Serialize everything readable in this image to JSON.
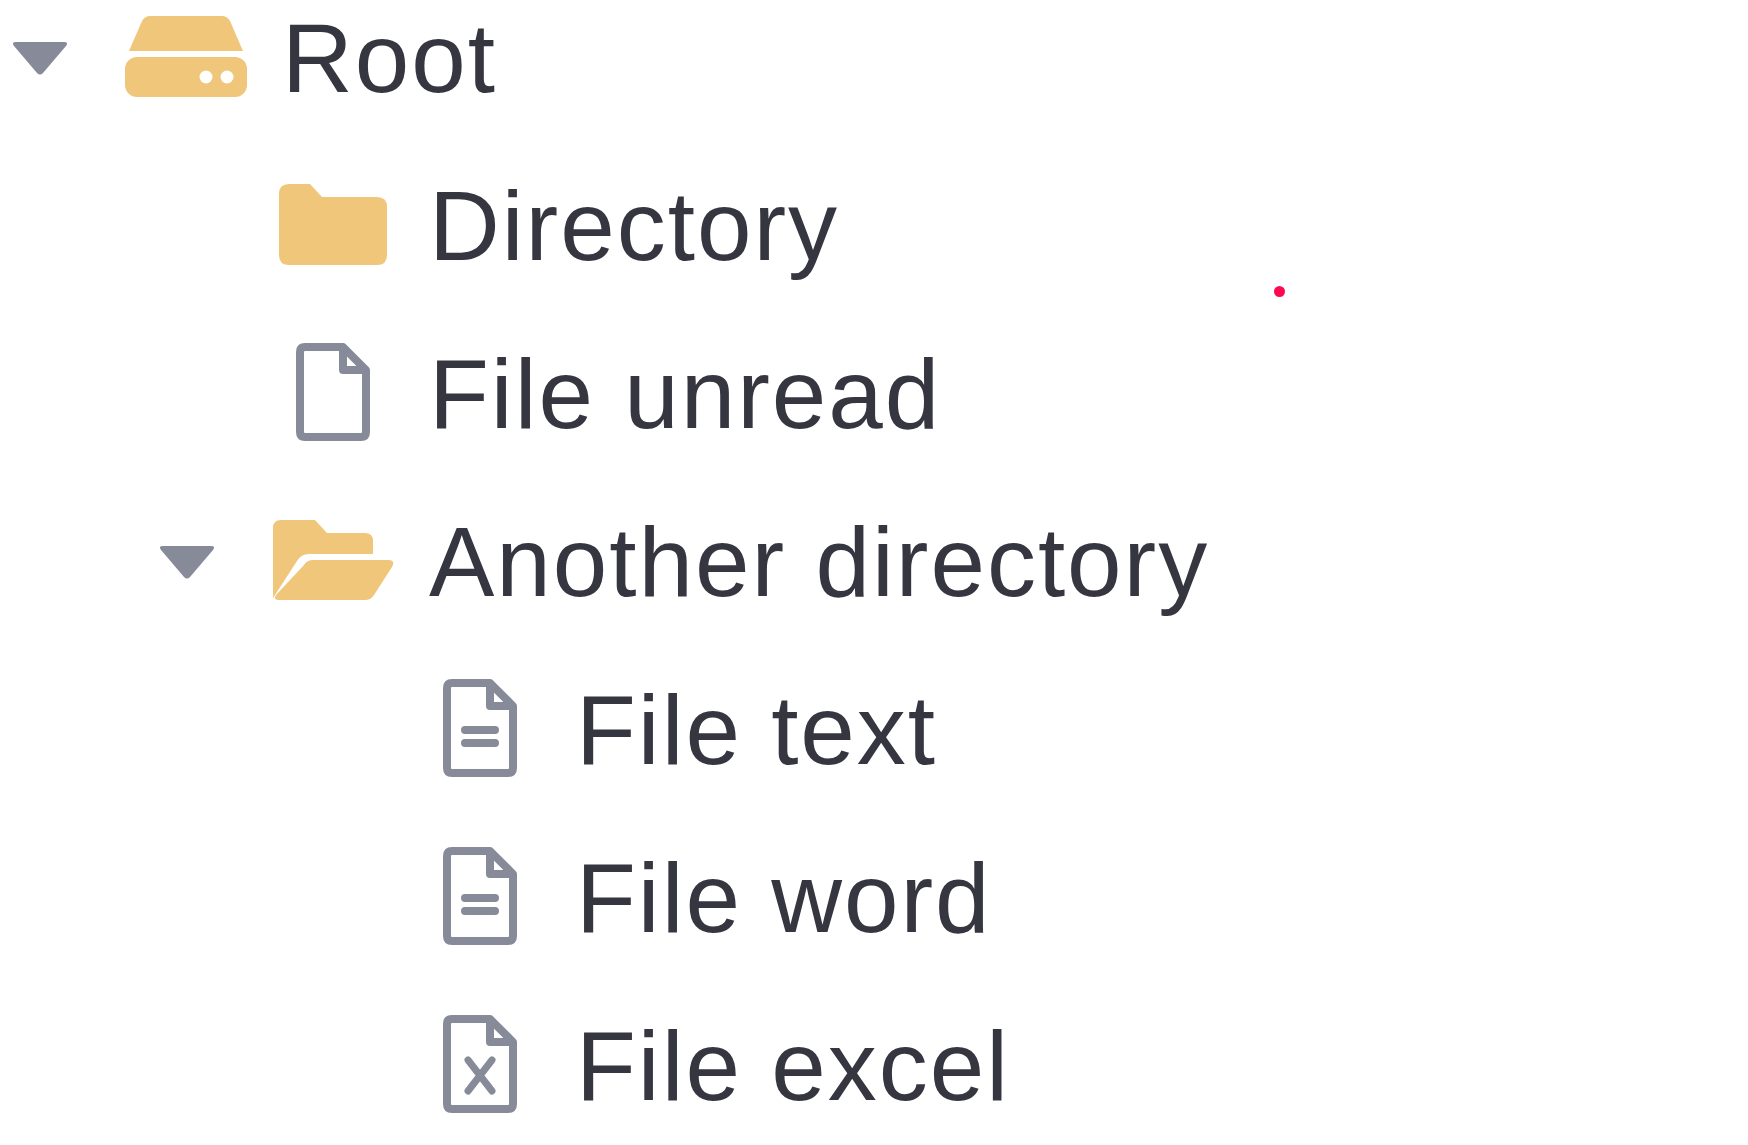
{
  "tree": {
    "items": [
      {
        "label": "Root",
        "kind": "drive",
        "expanded": true,
        "children": [
          {
            "label": "Directory",
            "kind": "folder",
            "expanded": false
          },
          {
            "label": "File unread",
            "kind": "file"
          },
          {
            "label": "Another directory",
            "kind": "folder",
            "expanded": true,
            "children": [
              {
                "label": "File text",
                "kind": "document"
              },
              {
                "label": "File word",
                "kind": "document"
              },
              {
                "label": "File excel",
                "kind": "spreadsheet"
              }
            ]
          }
        ]
      }
    ]
  }
}
